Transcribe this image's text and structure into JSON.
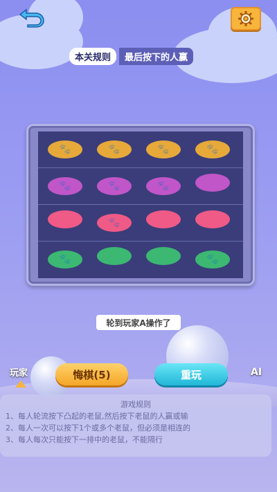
{
  "header": {
    "back_icon": "back-arrow-icon",
    "settings_icon": "gear-icon",
    "rule_tag": "本关规则",
    "rule_text": "最后按下的人赢"
  },
  "board": {
    "rows": [
      {
        "color": "#e6a93a",
        "cells": [
          "paw",
          "paw",
          "paw",
          "paw"
        ]
      },
      {
        "color": "#c056c8",
        "cells": [
          "paw",
          "paw",
          "paw",
          "up"
        ]
      },
      {
        "color": "#ef5a86",
        "cells": [
          "up",
          "paw",
          "up",
          "up"
        ]
      },
      {
        "color": "#3cb873",
        "cells": [
          "paw",
          "up",
          "up",
          "paw"
        ]
      }
    ]
  },
  "status": {
    "turn_text": "轮到玩家A操作了"
  },
  "controls": {
    "player_label": "玩家",
    "ai_label": "AI",
    "undo_label": "悔棋(5)",
    "restart_label": "重玩"
  },
  "rules": {
    "title": "游戏规则",
    "line1": "1、每人轮流按下凸起的老鼠,然后按下老鼠的人赢或输",
    "line2": "2、每人一次可以按下1个或多个老鼠，但必须是相连的",
    "line3": "3、每人每次只能按下一排中的老鼠，不能隔行"
  }
}
